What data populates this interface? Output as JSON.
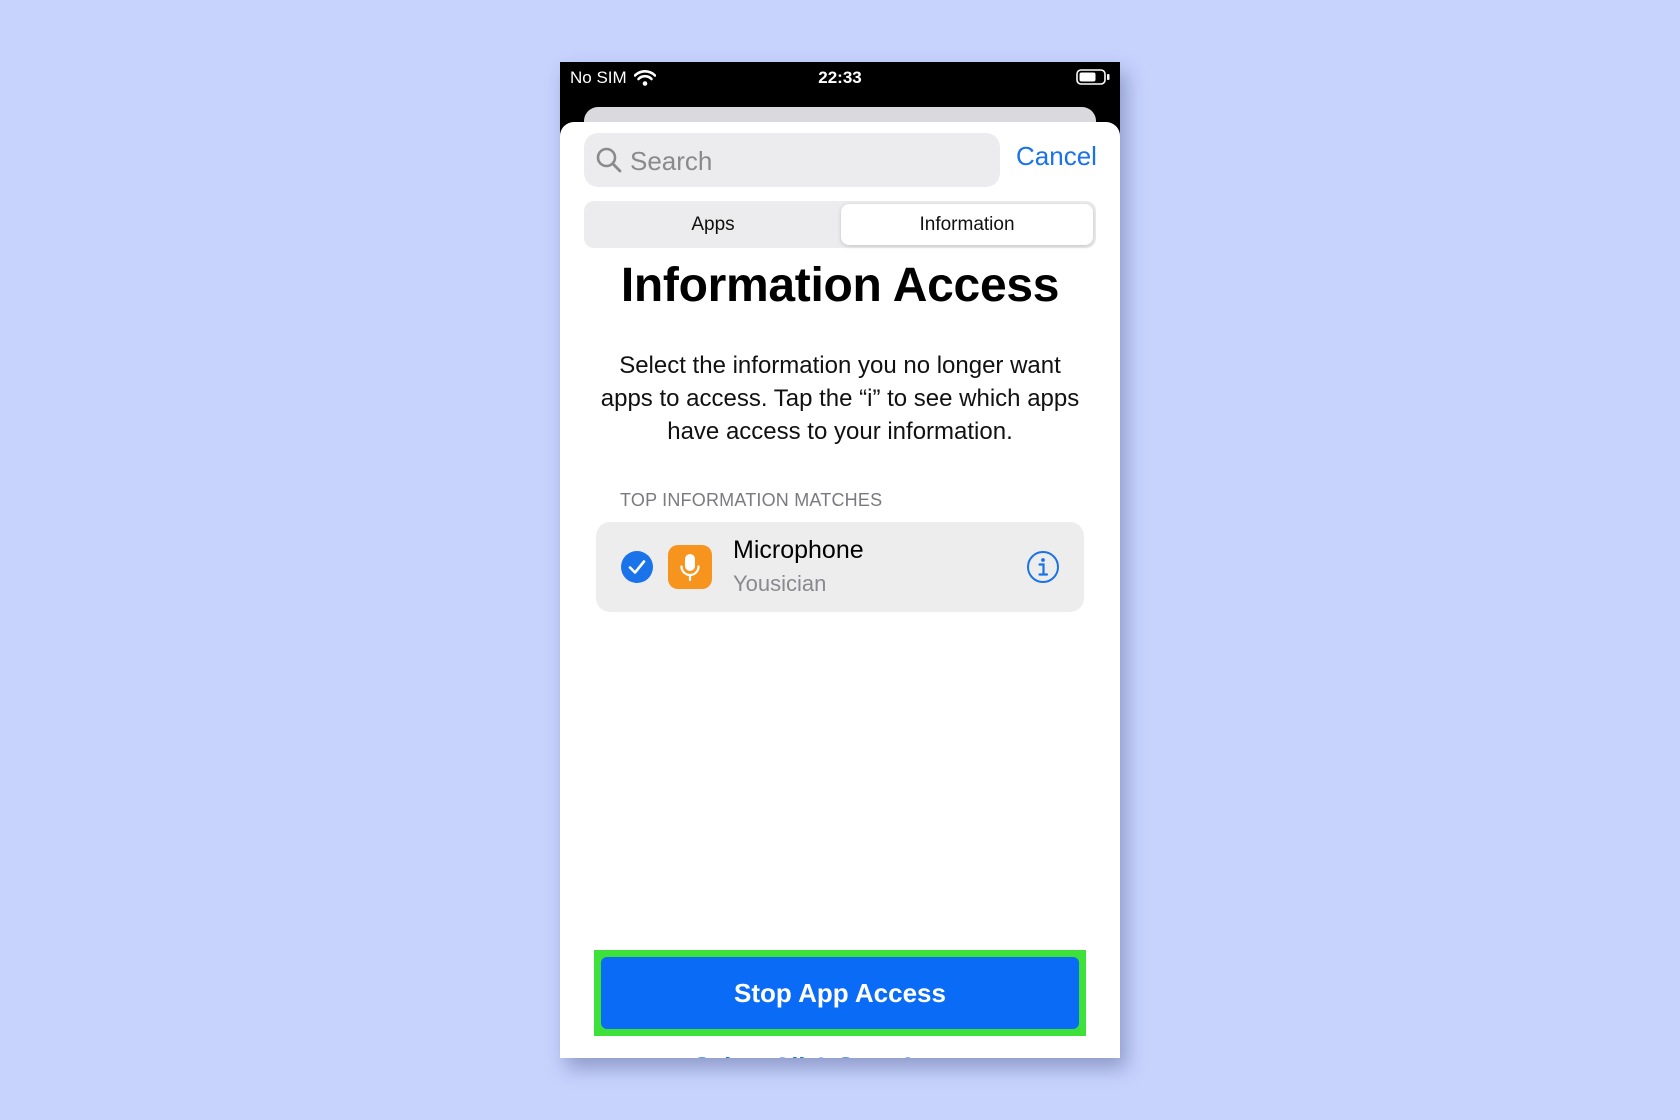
{
  "status_bar": {
    "carrier": "No SIM",
    "time": "22:33",
    "icons": [
      "wifi-icon",
      "battery-icon"
    ]
  },
  "search": {
    "placeholder": "Search",
    "value": "",
    "cancel_label": "Cancel"
  },
  "segmented_control": {
    "segments": [
      {
        "label": "Apps",
        "selected": false
      },
      {
        "label": "Information",
        "selected": true
      }
    ]
  },
  "main": {
    "title": "Information Access",
    "description": "Select the information you no longer want apps to access. Tap the “i” to see which apps have access to your information."
  },
  "section": {
    "header": "TOP INFORMATION MATCHES",
    "items": [
      {
        "title": "Microphone",
        "subtitle": "Yousician",
        "selected": true,
        "icon": "microphone-icon",
        "icon_color": "#f7941d",
        "detail_icon": "info-icon"
      }
    ]
  },
  "actions": {
    "primary_label": "Stop App Access",
    "secondary_label": "Select All & Stop Access"
  },
  "colors": {
    "background": "#c7d3fd",
    "accent": "#1a73e8",
    "primary_button": "#0a6cf6",
    "highlight": "#3ee03a"
  }
}
